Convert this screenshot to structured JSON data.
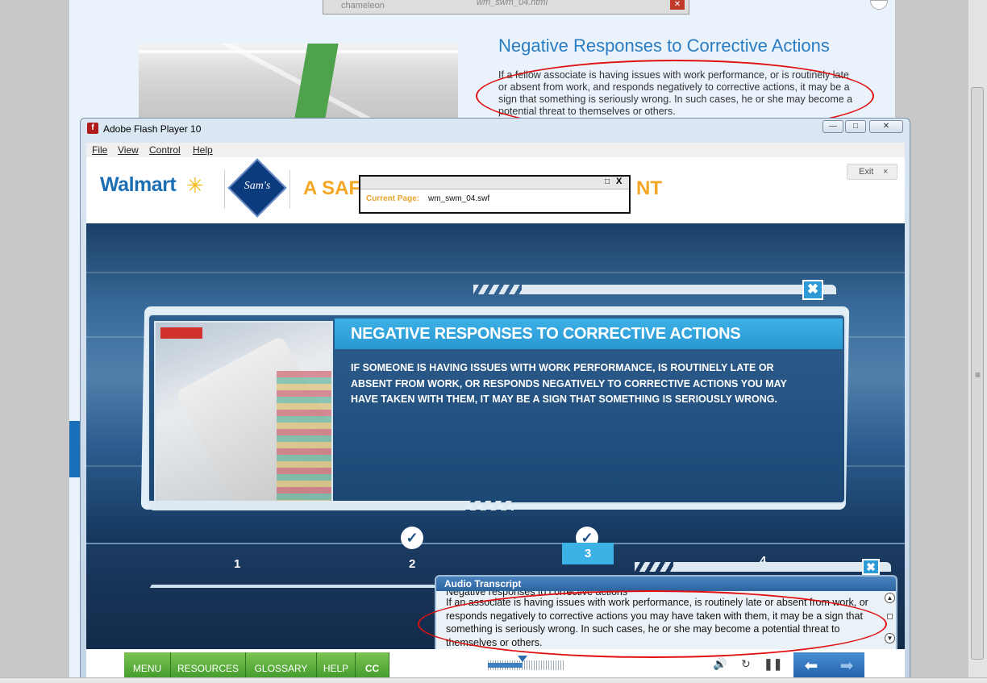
{
  "browser": {
    "popup_title": "wm_swm_04.html",
    "popup_brand": "chameleon",
    "page_heading": "Negative Responses to Corrective Actions",
    "page_body": "If a fellow associate is having issues with work performance, or is routinely late or absent from work, and responds negatively to corrective actions, it may be a sign that something is seriously wrong.  In such cases, he or she may become a potential threat to themselves or others."
  },
  "flash_window": {
    "title": "Adobe Flash Player 10",
    "menu": [
      "File",
      "View",
      "Control",
      "Help"
    ]
  },
  "header": {
    "walmart": "Walmart",
    "sams": "Sam's",
    "course_title_start": "A SAF",
    "course_title_end": "NT",
    "exit_label": "Exit",
    "exit_icon": "×"
  },
  "current_page": {
    "label": "Current Page:",
    "value": "wm_swm_04.swf"
  },
  "card": {
    "title": "NEGATIVE RESPONSES TO CORRECTIVE ACTIONS",
    "body": "IF SOMEONE IS HAVING ISSUES WITH WORK PERFORMANCE, IS ROUTINELY LATE OR ABSENT FROM WORK, OR RESPONDS NEGATIVELY TO CORRECTIVE ACTIONS YOU MAY HAVE TAKEN WITH THEM, IT MAY BE A SIGN THAT SOMETHING IS SERIOUSLY WRONG."
  },
  "progress": {
    "steps": [
      "1",
      "2",
      "3",
      "4"
    ],
    "completed": [
      "1",
      "2"
    ],
    "current": "3"
  },
  "transcript": {
    "title": "Audio Transcript",
    "cut_heading": "Negative responses to corrective actions",
    "text": "If an associate is having issues with work performance, is routinely late or absent from work, or responds negatively to corrective actions you may have taken with them, it may be a sign that something is seriously wrong.  In such cases, he or she may become a potential threat to themselves or others."
  },
  "footer": {
    "nav": [
      "MENU",
      "RESOURCES",
      "GLOSSARY",
      "HELP",
      "CC"
    ],
    "media_progress": 0.45
  },
  "colors": {
    "walmart_blue": "#1b6eb4",
    "accent_orange": "#f5a623",
    "nav_green": "#5fae3d",
    "annotation_red": "#e01010"
  }
}
